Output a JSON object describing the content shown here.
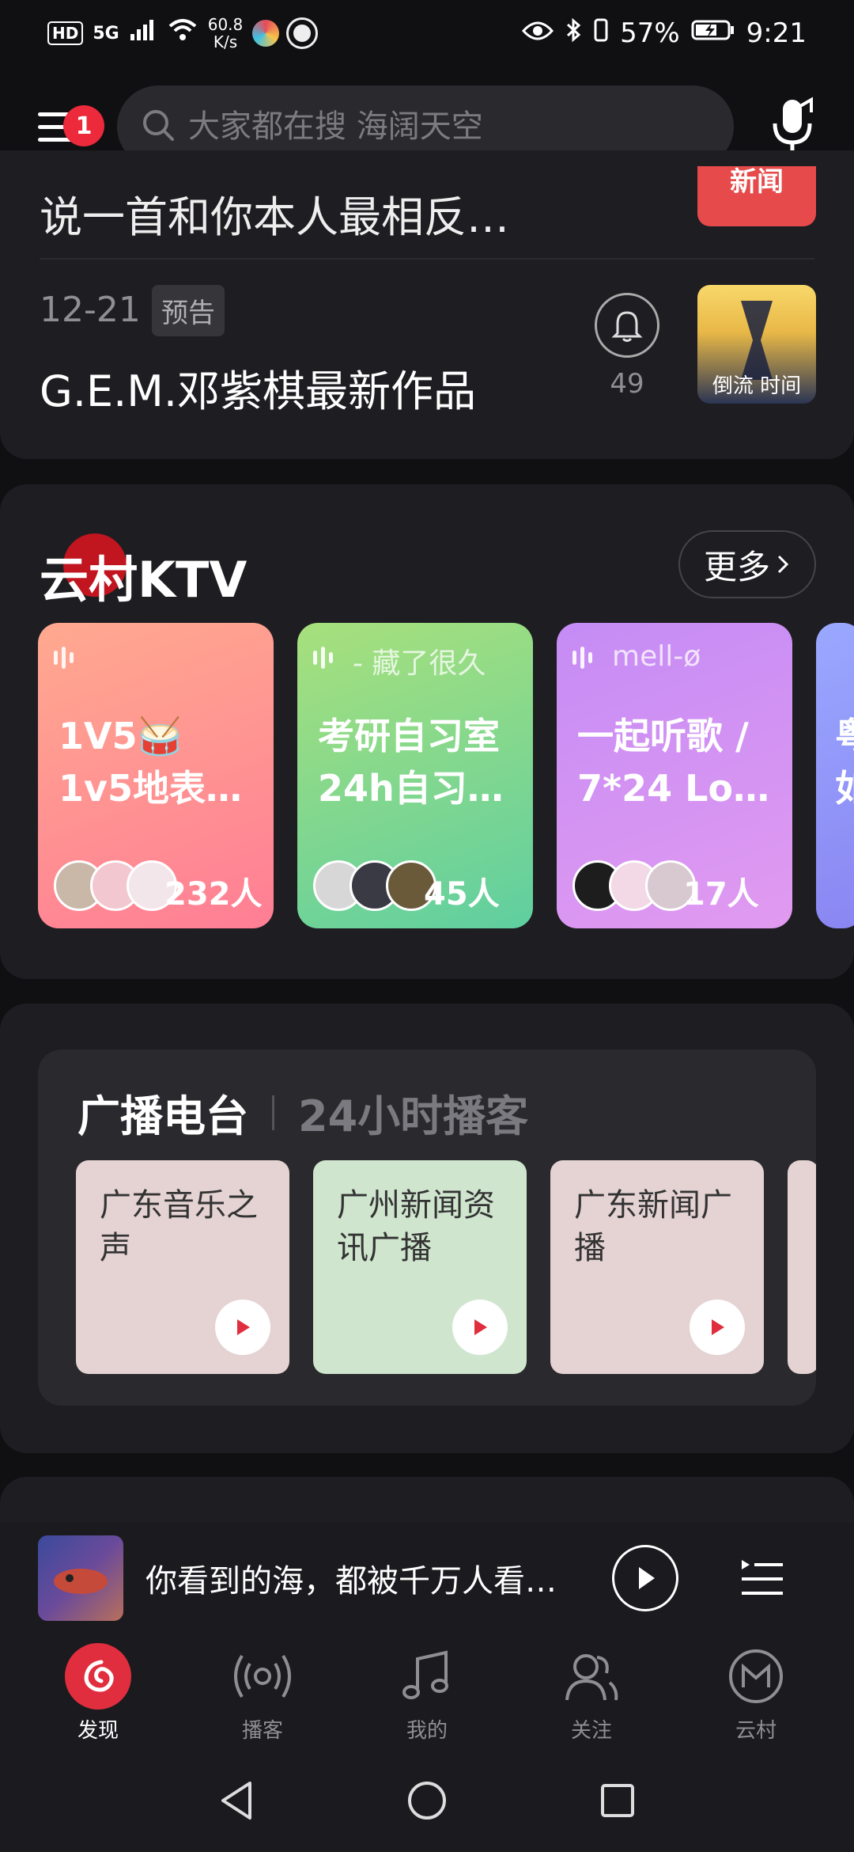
{
  "status_bar": {
    "hd": "HD",
    "signal": "5G",
    "net_speed_value": "60.8",
    "net_speed_unit": "K/s",
    "battery_percent": "57%",
    "time": "9:21"
  },
  "header": {
    "menu_badge": "1",
    "search_placeholder": "大家都在搜 海阔天空"
  },
  "news": {
    "row1_title": "说一首和你本人最相反…",
    "row1_thumb_text": "新闻",
    "date": "12-21",
    "tag": "预告",
    "row2_title": "G.E.M.邓紫棋最新作品",
    "bell_count": "49",
    "album_text": "倒流 时间"
  },
  "ktv": {
    "title": "云村KTV",
    "more_label": "更多",
    "rooms": [
      {
        "marquee": "",
        "title": "1V5🥁 1v5地表…",
        "count": "232人"
      },
      {
        "marquee": "- 藏了很久",
        "title": "考研自习室 24h自习…",
        "count": "45人"
      },
      {
        "marquee": "mell-ø",
        "title": "一起听歌 / 7*24 Lo…",
        "count": "17人"
      },
      {
        "marquee": "",
        "title": "粤 如",
        "count": ""
      }
    ]
  },
  "radio": {
    "tab_active": "广播电台",
    "tab_other": "24小时播客",
    "stations": [
      {
        "name": "广东音乐之声",
        "bg": "#e5d3d3"
      },
      {
        "name": "广州新闻资讯广播",
        "bg": "#cfe5ce"
      },
      {
        "name": "广东新闻广播",
        "bg": "#e5d3d3"
      }
    ]
  },
  "player": {
    "title": "你看到的海，都被千万人看…"
  },
  "tabs": [
    {
      "label": "发现"
    },
    {
      "label": "播客"
    },
    {
      "label": "我的"
    },
    {
      "label": "关注"
    },
    {
      "label": "云村"
    }
  ],
  "colors": {
    "accent": "#e02e3e",
    "background": "#101013",
    "card": "#1e1e22"
  }
}
